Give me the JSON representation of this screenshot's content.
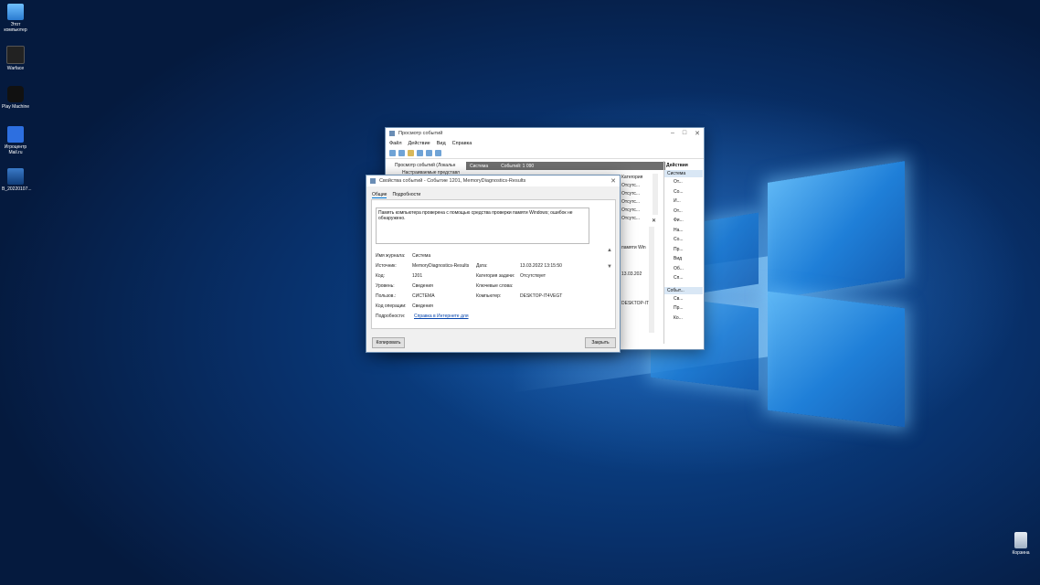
{
  "desktop": {
    "icons": [
      {
        "label": "Этот компьютер",
        "icon": "computer-icon"
      },
      {
        "label": "Warface",
        "icon": "warface-icon"
      },
      {
        "label": "Play Machine",
        "icon": "gamepad-icon"
      },
      {
        "label": "Игроцентр Mail.ru",
        "icon": "mailru-games-icon"
      },
      {
        "label": "B_20220107...",
        "icon": "screenshot-file-icon"
      }
    ],
    "recycle_bin": "Корзина"
  },
  "event_viewer": {
    "title": "Просмотр событий",
    "menu": [
      "Файл",
      "Действие",
      "Вид",
      "Справка"
    ],
    "tree_root": "Просмотр событий (Локальн",
    "tree_child": "Настраиваемые представл",
    "log_header": {
      "name": "Система",
      "count": "Событий: 1 090"
    },
    "column_header": "Категория",
    "list_values": [
      "Отсутс...",
      "Отсутс...",
      "Отсутс...",
      "Отсутс...",
      "Отсутс..."
    ],
    "detail_fragments": [
      "памяти Win",
      "13.03.202",
      "DESKTOP-IT4"
    ],
    "actions": {
      "title": "Действия",
      "section1": "Система",
      "items1": [
        "От...",
        "Со...",
        "И...",
        "От...",
        "Фи...",
        "На...",
        "Со...",
        "Пр...",
        "Вид",
        "Об...",
        "Сп..."
      ],
      "section2": "Событ...",
      "items2": [
        "Св...",
        "Пр...",
        "Ко..."
      ]
    }
  },
  "properties_dialog": {
    "title": "Свойства событий - Событие 1201, MemoryDiagnostics-Results",
    "tabs": [
      "Общие",
      "Подробности"
    ],
    "message": "Память компьютера проверена с помощью средства проверки памяти Windows; ошибок не обнаружено.",
    "fields": {
      "log_label": "Имя журнала:",
      "log_value": "Система",
      "source_label": "Источник:",
      "source_value": "MemoryDiagnostics-Results",
      "date_label": "Дата:",
      "date_value": "13.03.2022 13:15:50",
      "code_label": "Код:",
      "code_value": "1201",
      "category_label": "Категория задачи:",
      "category_value": "Отсутствует",
      "level_label": "Уровень:",
      "level_value": "Сведения",
      "keywords_label": "Ключевые слова:",
      "keywords_value": "",
      "user_label": "Пользов.:",
      "user_value": "СИСТЕМА",
      "computer_label": "Компьютер:",
      "computer_value": "DESKTOP-IT4VEGT",
      "opcode_label": "Код операции:",
      "opcode_value": "Сведения",
      "details_label": "Подробности:",
      "details_link": "Справка в Интернете для"
    },
    "copy_button": "Копировать",
    "close_button": "Закрыть"
  }
}
